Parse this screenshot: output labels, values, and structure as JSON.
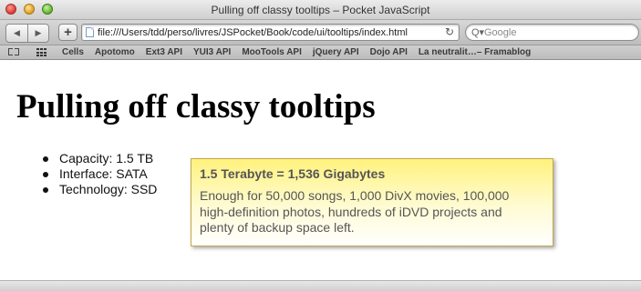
{
  "window": {
    "title": "Pulling off classy tooltips – Pocket JavaScript",
    "accent_colors": {
      "close": "#e0443e",
      "minimize": "#e3a82c",
      "maximize": "#6fbb3b"
    }
  },
  "toolbar": {
    "back_icon": "◀",
    "forward_icon": "▶",
    "add_icon": "+",
    "url": "file:///Users/tdd/perso/livres/JSPocket/Book/code/ui/tooltips/index.html",
    "reload_icon": "↻",
    "search_placeholder": "Google",
    "search_icon": "Q▾"
  },
  "bookmarks": {
    "items": [
      "Cells",
      "Apotomo",
      "Ext3 API",
      "YUI3 API",
      "MooTools API",
      "jQuery API",
      "Dojo API",
      "La neutralit…– Framablog"
    ]
  },
  "page": {
    "heading": "Pulling off classy tooltips",
    "specs": [
      "Capacity: 1.5 TB",
      "Interface: SATA",
      "Technology: SSD"
    ],
    "tooltip": {
      "title": "1.5 Terabyte = 1,536 Gigabytes",
      "body": "Enough for 50,000 songs, 1,000 DivX movies, 100,000 high-definition photos, hundreds of iDVD projects and plenty of backup space left."
    }
  }
}
